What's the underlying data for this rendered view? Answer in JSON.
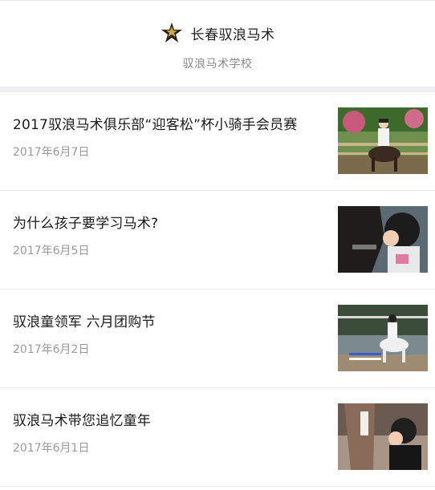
{
  "header": {
    "brand_name": "长春驭浪马术",
    "subtitle": "驭浪马术学校",
    "logo_icon": "star-badge-icon"
  },
  "articles": [
    {
      "title": "2017驭浪马术俱乐部“迎客松”杯小骑手会员赛",
      "date": "2017年6月7日",
      "thumb_icon": "rider-on-horse-photo"
    },
    {
      "title": "为什么孩子要学习马术?",
      "date": "2017年6月5日",
      "thumb_icon": "child-kissing-horse-photo"
    },
    {
      "title": "驭浪童领军 六月团购节",
      "date": "2017年6月2日",
      "thumb_icon": "arena-riding-photo"
    },
    {
      "title": "驭浪马术带您追忆童年",
      "date": "2017年6月1日",
      "thumb_icon": "child-with-horse-photo"
    }
  ],
  "colors": {
    "title": "#1a1a1a",
    "date": "#9a9a9a",
    "divider": "#eeeef2",
    "logo_gold": "#c9a64a"
  }
}
